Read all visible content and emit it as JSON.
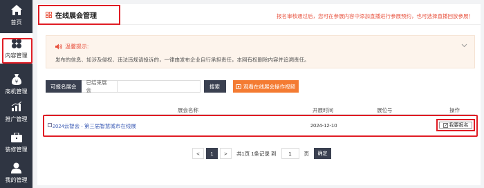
{
  "sidebar": {
    "items": [
      {
        "label": "首页",
        "icon": "home-icon"
      },
      {
        "label": "内容管理",
        "icon": "clover-icon",
        "active": true
      },
      {
        "label": "商机管理",
        "icon": "money-bag-icon"
      },
      {
        "label": "推广管理",
        "icon": "bar-chart-icon"
      },
      {
        "label": "装修管理",
        "icon": "briefcase-icon"
      },
      {
        "label": "我的管理",
        "icon": "user-icon"
      }
    ]
  },
  "header": {
    "title": "在线展会管理",
    "notice": "报名审核通过后，您可在参展内容中添加直播进行参展预约，也可选择直播回放参展！"
  },
  "warning": {
    "heading": "温馨提示:",
    "text": "发布的信息、如涉及侵权、违法违规请投诉的，一律由发布企业自行承担责任，本网有权删除内容并追溯责任。"
  },
  "filters": {
    "tab_active": "可报名展会",
    "tab_ended": "已结束展会",
    "search_placeholder": "",
    "search_button": "搜索",
    "video_button": "观看在线展会操作视频"
  },
  "table": {
    "columns": [
      "展会名称",
      "开展时间",
      "展位号",
      "操作"
    ],
    "rows": [
      {
        "name": "2024云智会 - 第三届智慧城市在线展",
        "date": "2024-12-10",
        "booth": "",
        "action": "我要报名"
      }
    ]
  },
  "pagination": {
    "prev": "<",
    "current": "1",
    "next": ">",
    "summary": "共1页 1条记录 到",
    "page_input": "1",
    "page_unit": "页",
    "go": "确定"
  },
  "colors": {
    "sidebar_bg": "#2f3542",
    "highlight_red": "#e01c24",
    "accent_orange": "#f47b32",
    "notice_red": "#e8533f",
    "link_blue": "#3b5bb5"
  }
}
